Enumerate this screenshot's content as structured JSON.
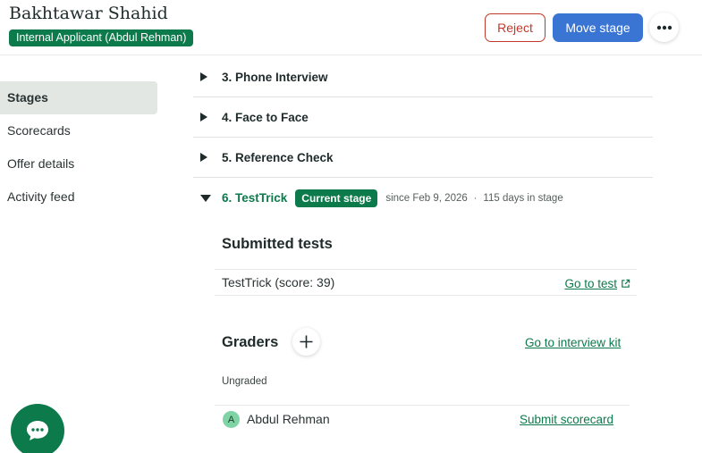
{
  "header": {
    "candidate_name": "Bakhtawar Shahid",
    "application_badge": "Internal Applicant (Abdul Rehman)",
    "reject_label": "Reject",
    "move_stage_label": "Move stage"
  },
  "sidebar": {
    "items": [
      {
        "label": "Stages",
        "active": true
      },
      {
        "label": "Scorecards",
        "active": false
      },
      {
        "label": "Offer details",
        "active": false
      },
      {
        "label": "Activity feed",
        "active": false
      }
    ]
  },
  "stages": [
    {
      "title": "3. Phone Interview",
      "expanded": false
    },
    {
      "title": "4. Face to Face",
      "expanded": false
    },
    {
      "title": "5. Reference Check",
      "expanded": false
    }
  ],
  "current_stage": {
    "title": "6. TestTrick",
    "badge": "Current stage",
    "since": "since Feb 9, 2026",
    "separator": "·",
    "days": "115 days in stage"
  },
  "submitted_tests": {
    "title": "Submitted tests",
    "tests": [
      {
        "name": "TestTrick (score: 39)",
        "link": "Go to test"
      }
    ]
  },
  "graders": {
    "title": "Graders",
    "kit_link": "Go to interview kit",
    "status": "Ungraded",
    "list": [
      {
        "initial": "A",
        "name": "Abdul Rehman",
        "action": "Submit scorecard"
      }
    ]
  },
  "colors": {
    "brand_green": "#0c7a4b",
    "primary_blue": "#3b75d4",
    "reject_red": "#c0392b"
  }
}
